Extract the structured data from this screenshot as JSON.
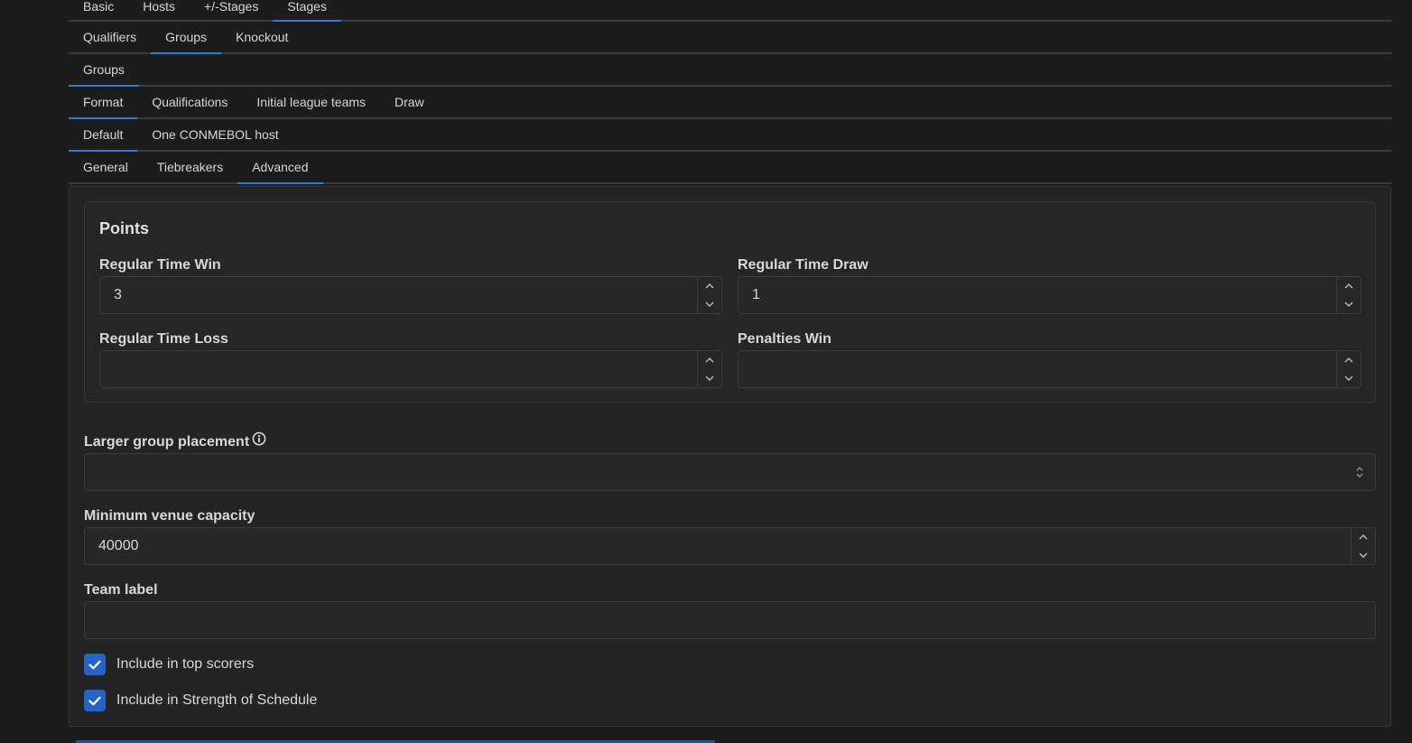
{
  "tabs_row1": {
    "items": [
      "Basic",
      "Hosts",
      "+/-Stages",
      "Stages"
    ],
    "active": 3
  },
  "tabs_row2": {
    "items": [
      "Qualifiers",
      "Groups",
      "Knockout"
    ],
    "active": 1
  },
  "tabs_row3": {
    "items": [
      "Groups"
    ],
    "active": 0
  },
  "tabs_row4": {
    "items": [
      "Format",
      "Qualifications",
      "Initial league teams",
      "Draw"
    ],
    "active": 0
  },
  "tabs_row5": {
    "items": [
      "Default",
      "One CONMEBOL host"
    ],
    "active": 0
  },
  "tabs_row6": {
    "items": [
      "General",
      "Tiebreakers",
      "Advanced"
    ],
    "active": 2
  },
  "points": {
    "legend": "Points",
    "regular_time_win": {
      "label": "Regular Time Win",
      "value": "3"
    },
    "regular_time_draw": {
      "label": "Regular Time Draw",
      "value": "1"
    },
    "regular_time_loss": {
      "label": "Regular Time Loss",
      "value": ""
    },
    "penalties_win": {
      "label": "Penalties Win",
      "value": ""
    }
  },
  "larger_group_placement": {
    "label": "Larger group placement",
    "value": ""
  },
  "minimum_venue_capacity": {
    "label": "Minimum venue capacity",
    "value": "40000"
  },
  "team_label": {
    "label": "Team label",
    "value": ""
  },
  "checkboxes": {
    "top_scorers": {
      "label": "Include in top scorers",
      "checked": true
    },
    "strength_of_schedule": {
      "label": "Include in Strength of Schedule",
      "checked": true
    }
  },
  "colors": {
    "accent": "#2f7bd8",
    "checkbox": "#2563c4",
    "background": "#1c1c1c"
  }
}
